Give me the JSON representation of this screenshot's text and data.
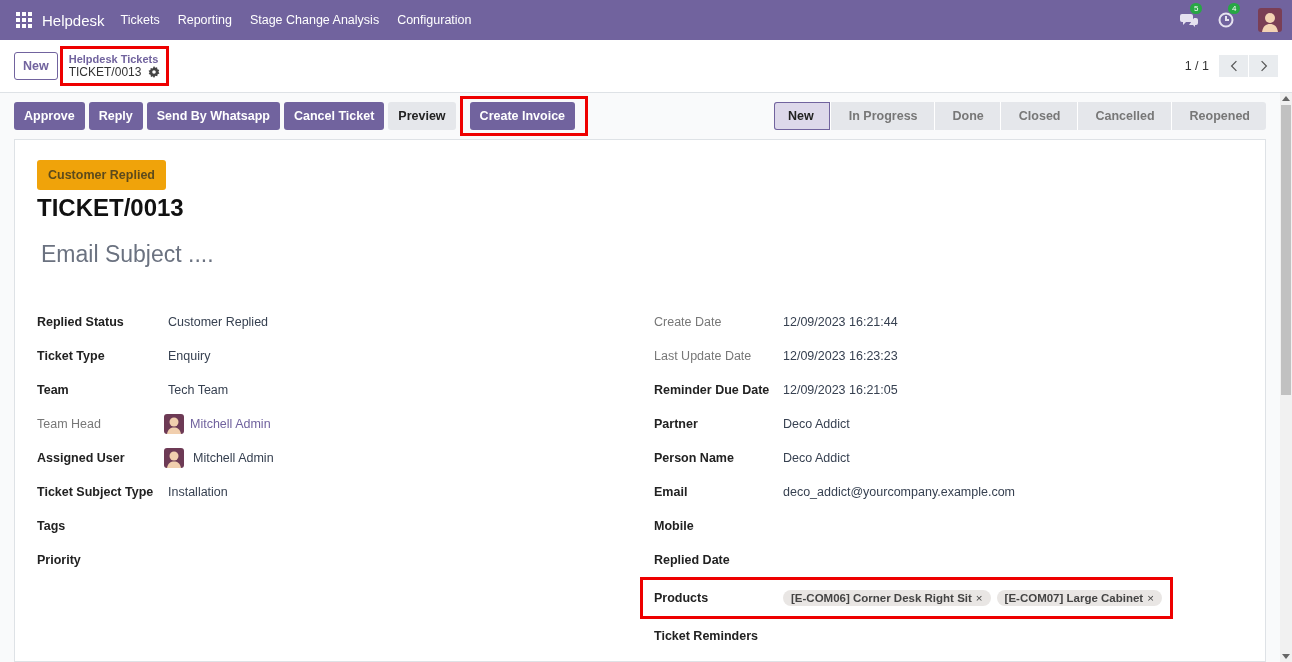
{
  "navbar": {
    "app": "Helpdesk",
    "menu": [
      "Tickets",
      "Reporting",
      "Stage Change Analysis",
      "Configuration"
    ],
    "messages_count": "5",
    "activities_count": "4"
  },
  "control_panel": {
    "new_button": "New",
    "breadcrumb": {
      "parent": "Helpdesk Tickets",
      "current": "TICKET/0013",
      "highlighted": true
    },
    "pager": "1 / 1"
  },
  "actions": [
    {
      "label": "Approve",
      "kind": "primary",
      "highlighted": false
    },
    {
      "label": "Reply",
      "kind": "primary",
      "highlighted": false
    },
    {
      "label": "Send By Whatsapp",
      "kind": "primary",
      "highlighted": false
    },
    {
      "label": "Cancel Ticket",
      "kind": "primary",
      "highlighted": false
    },
    {
      "label": "Preview",
      "kind": "secondary",
      "highlighted": false
    },
    {
      "label": "Create Invoice",
      "kind": "primary",
      "highlighted": true
    }
  ],
  "stages": [
    {
      "label": "New",
      "selected": true
    },
    {
      "label": "In Progress",
      "selected": false
    },
    {
      "label": "Done",
      "selected": false
    },
    {
      "label": "Closed",
      "selected": false
    },
    {
      "label": "Cancelled",
      "selected": false
    },
    {
      "label": "Reopened",
      "selected": false
    }
  ],
  "form": {
    "status_badge": "Customer Replied",
    "title": "TICKET/0013",
    "subject_placeholder": "Email Subject ....",
    "left": [
      {
        "label": "Replied Status",
        "label_muted": false,
        "kind": "text",
        "value": "Customer Replied",
        "highlighted": false
      },
      {
        "label": "Ticket Type",
        "label_muted": false,
        "kind": "text",
        "value": "Enquiry",
        "highlighted": false
      },
      {
        "label": "Team",
        "label_muted": false,
        "kind": "text",
        "value": "Tech Team",
        "highlighted": false
      },
      {
        "label": "Team Head",
        "label_muted": true,
        "kind": "user-link",
        "value": "Mitchell Admin",
        "highlighted": false
      },
      {
        "label": "Assigned User",
        "label_muted": false,
        "kind": "user",
        "value": "Mitchell Admin",
        "highlighted": false
      },
      {
        "label": "Ticket Subject Type",
        "label_muted": false,
        "kind": "text",
        "value": "Installation",
        "highlighted": false
      },
      {
        "label": "Tags",
        "label_muted": false,
        "kind": "text",
        "highlighted": false
      },
      {
        "label": "Priority",
        "label_muted": false,
        "kind": "text",
        "highlighted": false
      }
    ],
    "right": [
      {
        "label": "Create Date",
        "label_muted": true,
        "kind": "text",
        "value": "12/09/2023 16:21:44",
        "highlighted": false
      },
      {
        "label": "Last Update Date",
        "label_muted": true,
        "kind": "text",
        "value": "12/09/2023 16:23:23",
        "highlighted": false
      },
      {
        "label": "Reminder Due Date",
        "label_muted": false,
        "kind": "text",
        "value": "12/09/2023 16:21:05",
        "highlighted": false
      },
      {
        "label": "Partner",
        "label_muted": false,
        "kind": "text",
        "value": "Deco Addict",
        "highlighted": false
      },
      {
        "label": "Person Name",
        "label_muted": false,
        "kind": "text",
        "value": "Deco Addict",
        "highlighted": false
      },
      {
        "label": "Email",
        "label_muted": false,
        "kind": "text",
        "value": "deco_addict@yourcompany.example.com",
        "highlighted": false
      },
      {
        "label": "Mobile",
        "label_muted": false,
        "kind": "text",
        "highlighted": false
      },
      {
        "label": "Replied Date",
        "label_muted": false,
        "kind": "text",
        "highlighted": false
      },
      {
        "label": "Products",
        "label_muted": false,
        "kind": "tags",
        "tags": [
          "[E-COM06] Corner Desk Right Sit",
          "[E-COM07] Large Cabinet"
        ],
        "remove_glyph": "×",
        "highlighted": true
      },
      {
        "label": "Ticket Reminders",
        "label_muted": false,
        "kind": "text",
        "highlighted": false
      }
    ]
  }
}
